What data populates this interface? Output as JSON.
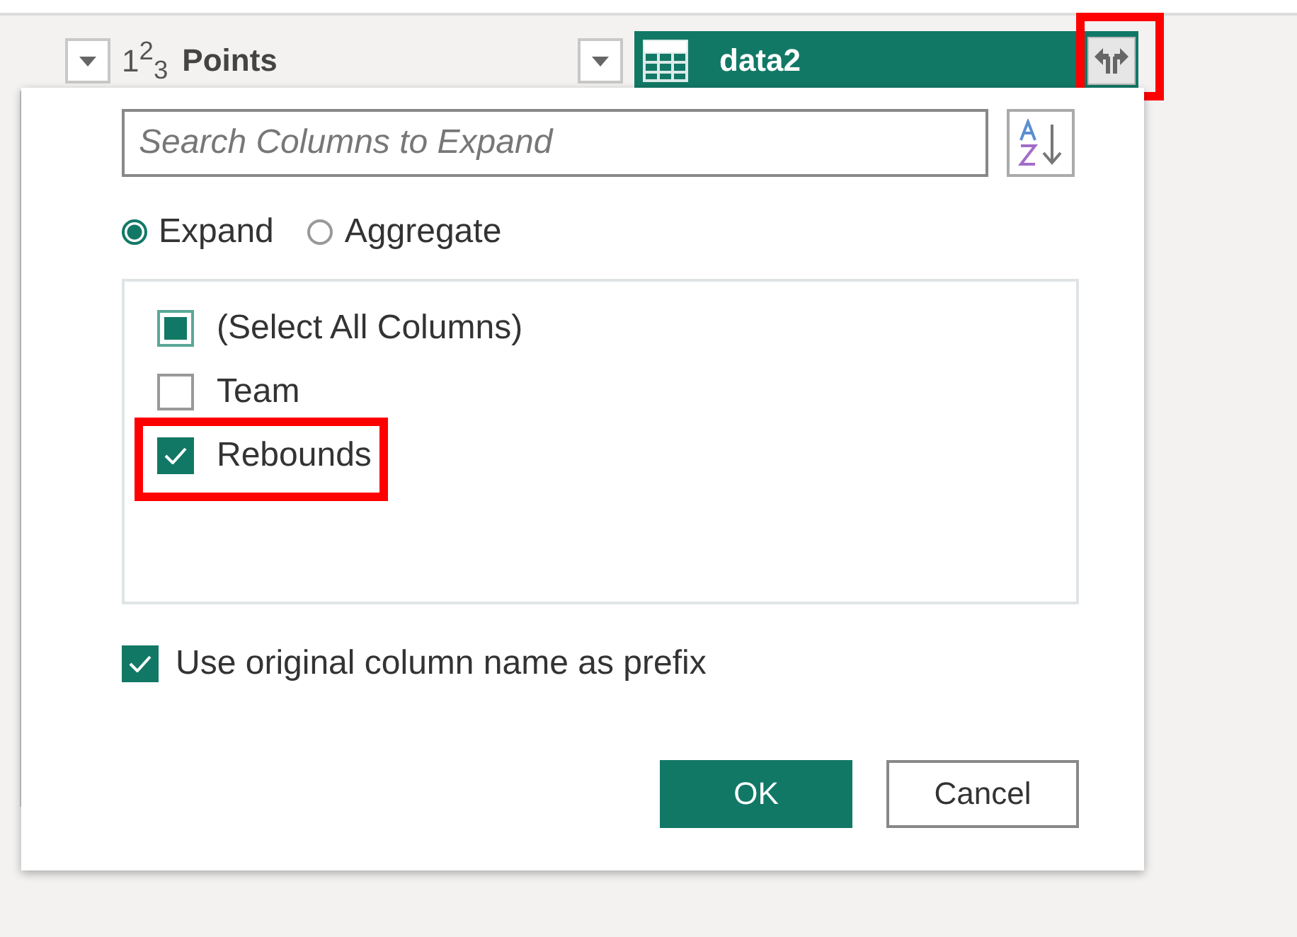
{
  "columns": [
    {
      "kind": "number",
      "type_icon": "1$^{2}$$_{3}$",
      "name": "Points",
      "selected": false
    },
    {
      "kind": "table",
      "name": "data2",
      "selected": true,
      "expand_highlighted": true
    }
  ],
  "dialog": {
    "search": {
      "placeholder": "Search Columns to Expand"
    },
    "modes": [
      {
        "label": "Expand",
        "selected": true
      },
      {
        "label": "Aggregate",
        "selected": false
      }
    ],
    "items": [
      {
        "label": "(Select All Columns)",
        "checked": false,
        "partial": true,
        "highlighted": false
      },
      {
        "label": "Team",
        "checked": false,
        "partial": false,
        "highlighted": false
      },
      {
        "label": "Rebounds",
        "checked": true,
        "partial": false,
        "highlighted": true
      }
    ],
    "prefix": {
      "label": "Use original column name as prefix",
      "checked": true
    },
    "buttons": [
      {
        "label": "OK",
        "kind": "primary"
      },
      {
        "label": "Cancel",
        "kind": "secondary"
      }
    ]
  }
}
